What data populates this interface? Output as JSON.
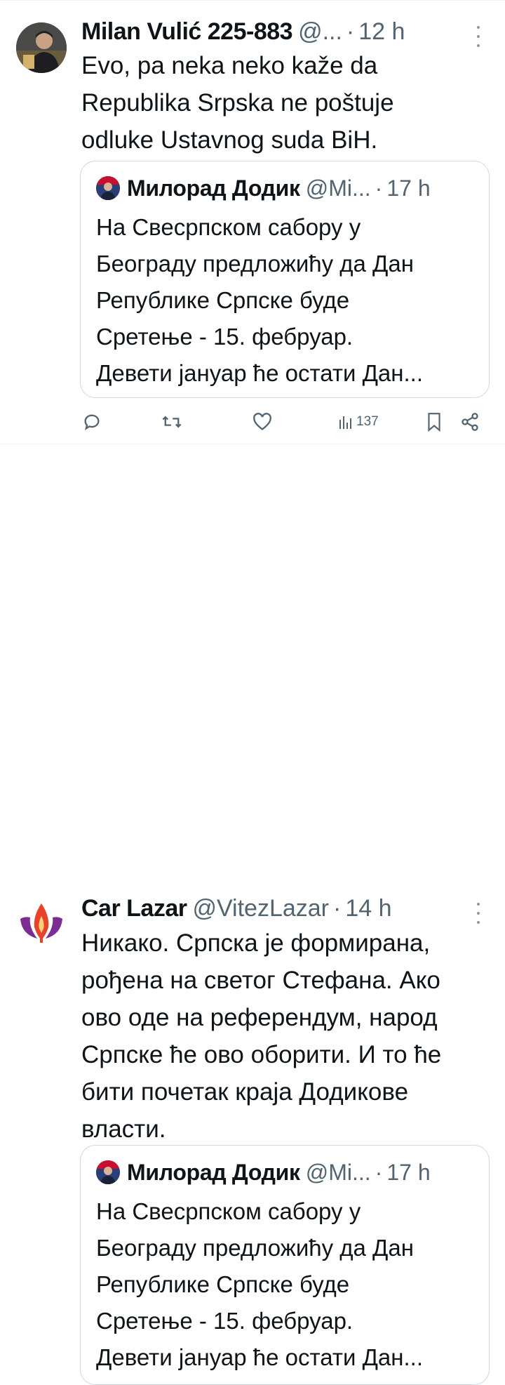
{
  "tweets": [
    {
      "author": "Milan Vulić 225-883",
      "handle": "@...",
      "separator": "·",
      "time": "12 h",
      "text": "Evo, pa neka neko kaže da\nRepublika Srpska ne poštuje\nodluke Ustavnog suda BiH.",
      "quote": {
        "author": "Милорад Додик",
        "handle": "@Mi...",
        "separator": "·",
        "time": "17 h",
        "text": "На Свесрпском сабору у\nБеограду предложићу да Дан\nРепублике Српске буде\nСретење - 15. фебруар.\nДевети јануар ће остати Дан..."
      },
      "actions": {
        "views": "137"
      }
    },
    {
      "author": "Car Lazar",
      "handle": "@VitezLazar",
      "separator": "·",
      "time": "14 h",
      "text": "Никако. Српска је формирана,\nрођена на светог Стефана. Ако\nово оде на референдум, народ\nСрпске ће ово оборити. И то ће\nбити почетак краја Додикове\nвласти.",
      "quote": {
        "author": "Милорад Додик",
        "handle": "@Mi...",
        "separator": "·",
        "time": "17 h",
        "text": "На Свесрпском сабору у\nБеограду предложићу да Дан\nРепублике Српске буде\nСретење - 15. фебруар.\nДевети јануар ће остати Дан..."
      }
    }
  ],
  "colors": {
    "text": "#0f1419",
    "secondary": "#536471",
    "border": "#cfd9de",
    "divider": "#eff3f4",
    "logo_purple": "#7b2d91",
    "logo_red": "#e8432a"
  },
  "icons": [
    "reply-icon",
    "retweet-icon",
    "like-icon",
    "views-icon",
    "bookmark-icon",
    "share-icon",
    "more-icon"
  ]
}
